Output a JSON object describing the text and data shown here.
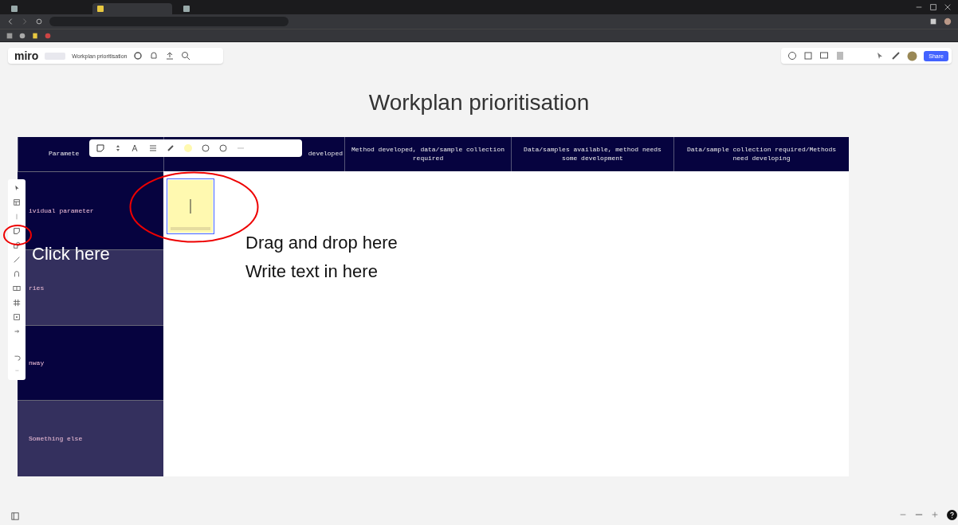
{
  "browser_tabs": [
    {
      "selected": false
    },
    {
      "selected": true
    },
    {
      "selected": false
    }
  ],
  "board": {
    "logo": "miro",
    "name": "Workplan prioritisation",
    "share": "Share"
  },
  "title": "Workplan prioritisation",
  "table": {
    "columns": [
      "Paramete",
      "developed",
      "Method developed, data/sample collection required",
      "Data/samples available, method needs some development",
      "Data/sample collection required/Methods need developing"
    ],
    "rows": [
      {
        "label": "ividual parameter",
        "color": "#06033f"
      },
      {
        "label": "ries",
        "color": "#34305e"
      },
      {
        "label": "nway",
        "color": "#06033f"
      },
      {
        "label": "Something else",
        "color": "#34305e"
      }
    ]
  },
  "sticky_note": {
    "selected": true
  },
  "annotations": [
    {
      "text": "Click here"
    },
    {
      "text": "Drag and drop here"
    },
    {
      "text": "Write text in here"
    }
  ]
}
